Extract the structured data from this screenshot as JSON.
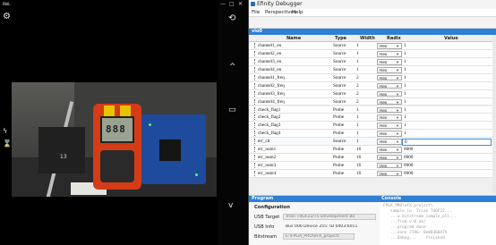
{
  "camera": {
    "title": "RWL",
    "window_controls": [
      "—",
      "□",
      "✕"
    ],
    "photo_meter_reading": "888"
  },
  "app": {
    "title": "Efinity Debugger",
    "menu": [
      "File",
      "Perspectives",
      "Help"
    ],
    "panel_tab": "vio0",
    "columns": [
      "Name",
      "Type",
      "Width",
      "Radix",
      "Value"
    ],
    "rows": [
      {
        "name": "channel1_en",
        "type": "Source",
        "width": "1",
        "radix": "Hex",
        "value": "1"
      },
      {
        "name": "channel2_en",
        "type": "Source",
        "width": "1",
        "radix": "Hex",
        "value": "1"
      },
      {
        "name": "channel3_en",
        "type": "Source",
        "width": "1",
        "radix": "Hex",
        "value": "1"
      },
      {
        "name": "channel4_en",
        "type": "Source",
        "width": "1",
        "radix": "Hex",
        "value": "1"
      },
      {
        "name": "channel1_freq",
        "type": "Source",
        "width": "2",
        "radix": "Hex",
        "value": "1"
      },
      {
        "name": "channel2_freq",
        "type": "Source",
        "width": "2",
        "radix": "Hex",
        "value": "1"
      },
      {
        "name": "channel3_freq",
        "type": "Source",
        "width": "2",
        "radix": "Hex",
        "value": "1"
      },
      {
        "name": "channel4_freq",
        "type": "Source",
        "width": "2",
        "radix": "Hex",
        "value": "1"
      },
      {
        "name": "check_flag1",
        "type": "Probe",
        "width": "1",
        "radix": "Hex",
        "value": "1"
      },
      {
        "name": "check_flag2",
        "type": "Probe",
        "width": "1",
        "radix": "Hex",
        "value": "1"
      },
      {
        "name": "check_flag3",
        "type": "Probe",
        "width": "1",
        "radix": "Hex",
        "value": "1"
      },
      {
        "name": "check_flag4",
        "type": "Probe",
        "width": "1",
        "radix": "Hex",
        "value": "1"
      },
      {
        "name": "err_clr",
        "type": "Source",
        "width": "1",
        "radix": "Hex",
        "value": "0"
      },
      {
        "name": "err_num1",
        "type": "Probe",
        "width": "16",
        "radix": "Hex",
        "value": "0000"
      },
      {
        "name": "err_num2",
        "type": "Probe",
        "width": "16",
        "radix": "Hex",
        "value": "0000"
      },
      {
        "name": "err_num3",
        "type": "Probe",
        "width": "16",
        "radix": "Hex",
        "value": "0000"
      },
      {
        "name": "err_num4",
        "type": "Probe",
        "width": "16",
        "radix": "Hex",
        "value": "0000"
      }
    ],
    "program_tab": "Program",
    "console_tab": "Console",
    "configuration_label": "Configuration",
    "usb_target_label": "USB Target",
    "usb_target_value": "Trion T4GF22/T5 Development Bo",
    "usb_info_label": "USB Info",
    "usb_info_value": "Bus 000 Device 255: ID 0403:6011",
    "bitstream_label": "Bitstream",
    "bitstream_value": "E:\\FPGA_PRO\\eFX_project\\",
    "console_lines": [
      "FPGA_PRO\\eFX_project\\",
      "   sample_io  Trion T4GF22...",
      "   ...w bitstream_sample_pll...",
      "   ...from v.0 ok/",
      "   ...program done",
      "   ...nnnn JTAG: 0x00360A79",
      "   ...Debug...    finished"
    ]
  }
}
